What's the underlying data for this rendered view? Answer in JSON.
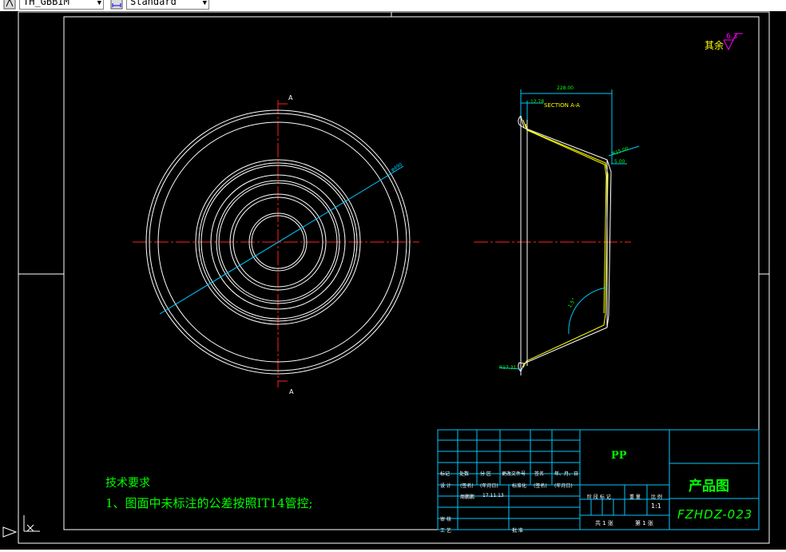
{
  "toolbar": {
    "textstyle_combo": "TH_GBBIM",
    "dimstyle_combo": "Standard"
  },
  "drawing": {
    "section_label_top": "A",
    "section_label_bottom": "A",
    "dia_label": "φ490",
    "section_title": "SECTION A-A",
    "dim_top_width": "228.00",
    "dim_small_top": "12.78",
    "dim_r15": "R15.00",
    "dim_5": "5.00",
    "dim_r17": "R17.31",
    "dim_angle": "1.5°",
    "roughness_prefix": "其余",
    "roughness_value": "6.3"
  },
  "notes": {
    "title": "技术要求",
    "line1": "1、图面中未标注的公差按照IT14管控;"
  },
  "title_block": {
    "material": "PP",
    "product_name": "产品图",
    "drawing_number": "FZHDZ-023",
    "scale": "1:1",
    "sheet_total": "共 1 张",
    "sheet_no": "第 1 张",
    "row_headers": [
      "标记",
      "处数",
      "分 区",
      "更改文件号",
      "签名",
      "年、月、日"
    ],
    "design_label": "设 计",
    "design_sign": "(签名)",
    "design_date": "(年月日)",
    "std_label": "标准化",
    "std_sign": "(签名)",
    "std_date": "(年月日)",
    "designer_name": "周鹏鹏",
    "design_date_val": "17.11.13",
    "check_label": "审 核",
    "process_label": "工 艺",
    "approve_label": "批 准",
    "stage_headers": [
      "阶 段 标 记",
      "重 量",
      "比 例"
    ]
  }
}
